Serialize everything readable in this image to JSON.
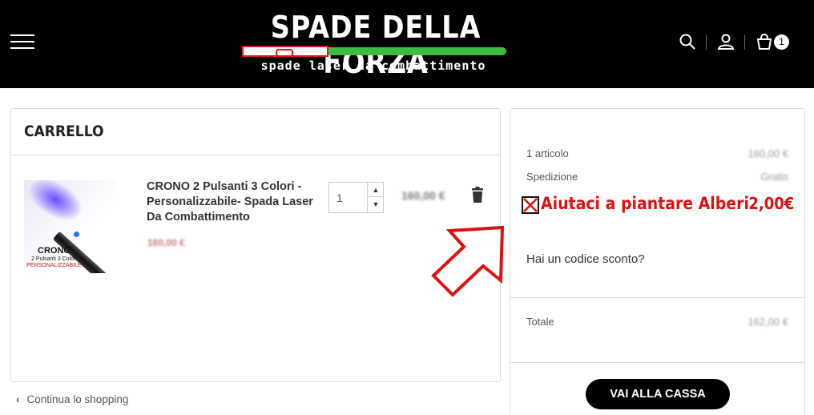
{
  "header": {
    "logo_title": "SPADE DELLA FORZA",
    "logo_subtitle": "spade laser da combattimento",
    "cart_count": "1",
    "icons": [
      "menu-icon",
      "search-icon",
      "user-icon",
      "cart-icon"
    ]
  },
  "cart": {
    "title": "CARRELLO",
    "item": {
      "name": "CRONO 2 Pulsanti 3 Colori - Personalizzabile- Spada Laser Da Combattimento",
      "unit_price": "160,00 €",
      "quantity": "1",
      "line_total": "160,00 €",
      "image_label": "CRONO",
      "image_sub": "2 Pulsanti 3 Colori",
      "image_sub2": "PERSONALIZZABILE"
    },
    "continue_label": "Continua lo shopping"
  },
  "summary": {
    "items_label": "1 articolo",
    "items_value": "160,00 €",
    "shipping_label": "Spedizione",
    "shipping_value": "Gratis",
    "promo_text": "Aiutaci a piantare Alberi",
    "promo_price": "2,00€",
    "discount_label": "Hai un codice sconto?",
    "total_label": "Totale",
    "total_value": "162,00 €",
    "checkout_label": "VAI ALLA CASSA"
  },
  "colors": {
    "header_bg": "#000000",
    "promo_red": "#e01010",
    "saber_green": "#3dbd3d",
    "saber_red": "#e0161b"
  }
}
